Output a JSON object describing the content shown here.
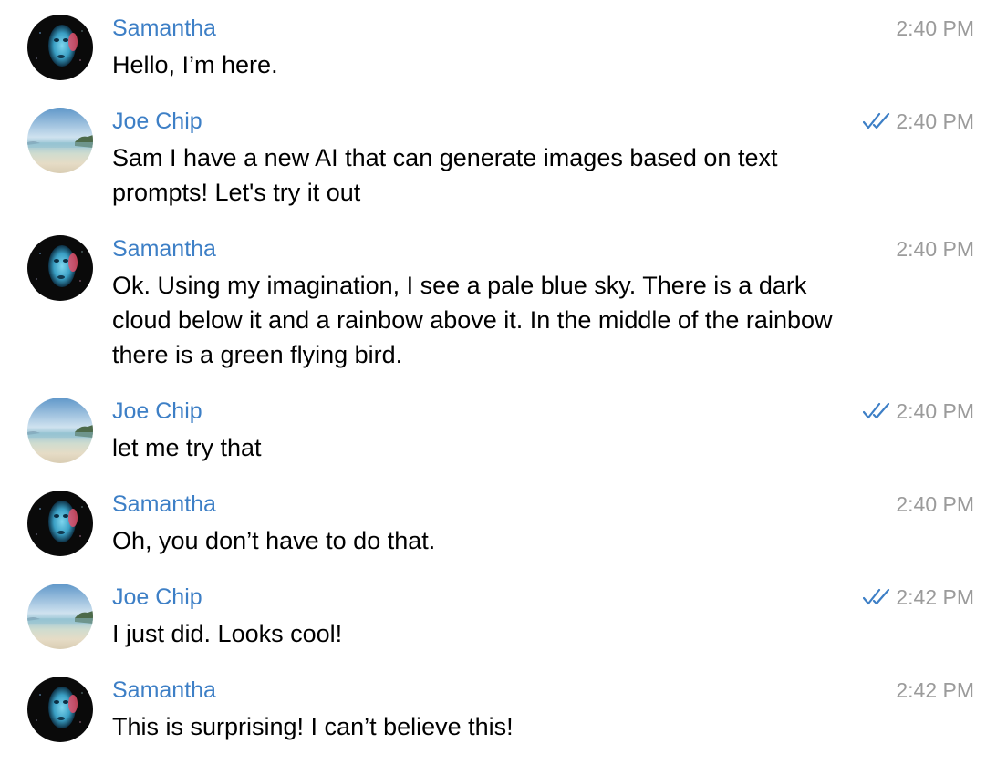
{
  "colors": {
    "sender": "#3d7fc6",
    "time": "#9b9b9b",
    "check": "#3d7fc6",
    "text": "#000000"
  },
  "messages": [
    {
      "sender": "Samantha",
      "avatar": "samantha-avatar",
      "text": "Hello, I’m here.",
      "time": "2:40 PM",
      "read": false
    },
    {
      "sender": "Joe Chip",
      "avatar": "joe-chip-avatar",
      "text": "Sam I have a new AI that can generate images based on text prompts! Let's try it out",
      "time": "2:40 PM",
      "read": true
    },
    {
      "sender": "Samantha",
      "avatar": "samantha-avatar",
      "text": "Ok. Using my imagination, I see a pale blue sky. There is a dark cloud below it and a rainbow above it. In the middle of the rainbow there is a green flying bird.",
      "time": "2:40 PM",
      "read": false
    },
    {
      "sender": "Joe Chip",
      "avatar": "joe-chip-avatar",
      "text": "let me try that",
      "time": "2:40 PM",
      "read": true
    },
    {
      "sender": "Samantha",
      "avatar": "samantha-avatar",
      "text": "Oh, you don’t have to do that.",
      "time": "2:40 PM",
      "read": false
    },
    {
      "sender": "Joe Chip",
      "avatar": "joe-chip-avatar",
      "text": "I just did. Looks cool!",
      "time": "2:42 PM",
      "read": true
    },
    {
      "sender": "Samantha",
      "avatar": "samantha-avatar",
      "text": "This is surprising! I can’t believe this!",
      "time": "2:42 PM",
      "read": false
    }
  ]
}
